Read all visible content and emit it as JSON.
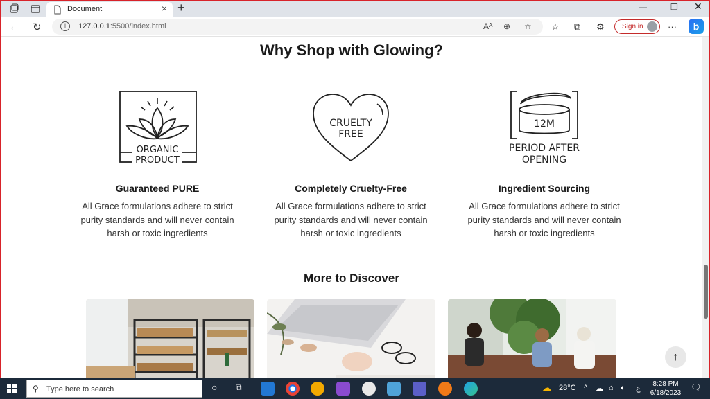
{
  "browser": {
    "tab_title": "Document",
    "url_host": "127.0.0.1",
    "url_rest": ":5500/index.html",
    "signin_label": "Sign in"
  },
  "page": {
    "heading": "Why Shop with Glowing?",
    "features": [
      {
        "icon": "organic-product-icon",
        "icon_text": [
          "ORGANIC",
          "PRODUCT"
        ],
        "title": "Guaranteed PURE",
        "description": "All Grace formulations adhere to strict purity standards and will never contain harsh or toxic ingredients"
      },
      {
        "icon": "cruelty-free-icon",
        "icon_text": [
          "CRUELTY",
          "FREE"
        ],
        "title": "Completely Cruelty-Free",
        "description": "All Grace formulations adhere to strict purity standards and will never contain harsh or toxic ingredients"
      },
      {
        "icon": "period-after-opening-icon",
        "icon_text": [
          "12M",
          "PERIOD AFTER",
          "OPENING"
        ],
        "title": "Ingredient Sourcing",
        "description": "All Grace formulations adhere to strict purity standards and will never contain harsh or toxic ingredients"
      }
    ],
    "discover_heading": "More to Discover",
    "back_to_top_icon": "arrow-up-icon"
  },
  "taskbar": {
    "search_placeholder": "Type here to search",
    "temperature": "28°C",
    "time": "8:28 PM",
    "date": "6/18/2023",
    "lang": "ع"
  },
  "colors": {
    "accent_red": "#c42b2b",
    "taskbar": "#1c2a3a"
  }
}
